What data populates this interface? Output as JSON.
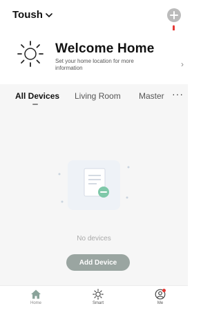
{
  "header": {
    "home_name": "Toush",
    "add_icon": "plus-circle-icon"
  },
  "welcome": {
    "title": "Welcome Home",
    "subtitle": "Set your home location for more information",
    "arrow": "›"
  },
  "tabs": {
    "items": [
      {
        "label": "All Devices",
        "active": true
      },
      {
        "label": "Living Room",
        "active": false
      },
      {
        "label": "Master",
        "active": false
      }
    ],
    "more_label": "···"
  },
  "empty_state": {
    "message": "No devices",
    "add_button_label": "Add Device"
  },
  "bottom_nav": {
    "items": [
      {
        "label": "Home",
        "icon": "home-icon"
      },
      {
        "label": "Smart",
        "icon": "sun-icon"
      },
      {
        "label": "Me",
        "icon": "profile-icon"
      }
    ]
  },
  "colors": {
    "accent_button": "#9aa5a1",
    "badge": "#e53935",
    "pointer_hand": "#e53935"
  }
}
